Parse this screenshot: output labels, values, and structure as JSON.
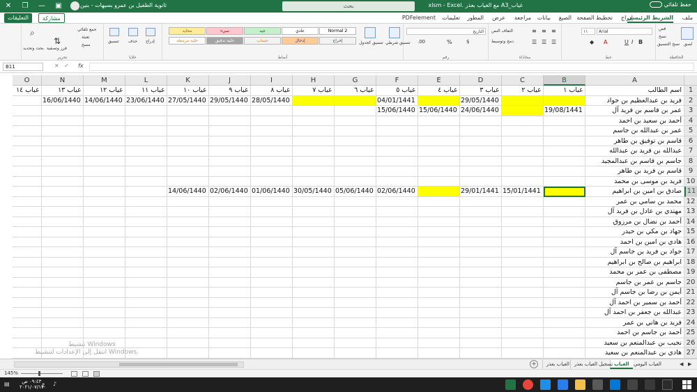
{
  "titlebar": {
    "autosave": "حفظ تلقائي",
    "filename": "غياب_A3 مع الغياب بعذر  .xlsm - Excel",
    "search_placeholder": "بحث",
    "user": "ثانوية الطفيل بن عمرو بسيهات - بنين"
  },
  "ribbon_tabs": [
    "ملف",
    "الشريط الرئيسي",
    "إدراج",
    "تخطيط الصفحة",
    "الصيغ",
    "بيانات",
    "مراجعة",
    "عرض",
    "المطور",
    "تعليمات",
    "PDFelement"
  ],
  "ribbon_active_tab": "الشريط الرئيسي",
  "share_label": "مشاركة",
  "comments_label": "التعليقات",
  "ribbon": {
    "clipboard": {
      "label": "الحافظة",
      "paste": "لصق",
      "cut": "قص",
      "copy": "نسخ",
      "format_painter": "نسخ التنسيق"
    },
    "font": {
      "label": "خط",
      "name": "Arial",
      "size": "١١"
    },
    "alignment": {
      "label": "محاذاة",
      "wrap": "التفاف النص",
      "merge": "دمج وتوسيط"
    },
    "number": {
      "label": "رقم",
      "format": "التاريخ",
      "percent": "%"
    },
    "styles": {
      "label": "أنماط",
      "conditional": "تنسيق شرطي",
      "format_table": "تنسيق كجدول",
      "items": [
        {
          "name": "Normal 2",
          "bg": "#ffffff",
          "fg": "#000000"
        },
        {
          "name": "عادي",
          "bg": "#ffffff",
          "fg": "#000000"
        },
        {
          "name": "جيد",
          "bg": "#c6efce",
          "fg": "#006100"
        },
        {
          "name": "سيء",
          "bg": "#ffc7ce",
          "fg": "#9c0006"
        },
        {
          "name": "محايد",
          "bg": "#ffeb9c",
          "fg": "#9c5700"
        },
        {
          "name": "إخراج",
          "bg": "#f2f2f2",
          "fg": "#3f3f3f"
        },
        {
          "name": "إدخال",
          "bg": "#ffcc99",
          "fg": "#3f3f76"
        },
        {
          "name": "حساب",
          "bg": "#f2f2f2",
          "fg": "#fa7d00"
        },
        {
          "name": "خلية تدقيق",
          "bg": "#a5a5a5",
          "fg": "#ffffff"
        },
        {
          "name": "خلية مرتبطة",
          "bg": "#ffffff",
          "fg": "#fa7d00"
        }
      ]
    },
    "cells": {
      "label": "خلايا",
      "insert": "إدراج",
      "delete": "حذف",
      "format": "تنسيق"
    },
    "editing": {
      "label": "تحرير",
      "autosum": "جمع تلقائي",
      "fill": "تعبئة",
      "clear": "مسح",
      "sort": "فرز وتصفية",
      "find": "بحث وتحديد"
    }
  },
  "formula_bar": {
    "name_box": "B11",
    "fx": "fx",
    "value": ""
  },
  "grid": {
    "columns": [
      "A",
      "B",
      "C",
      "D",
      "E",
      "F",
      "G",
      "H",
      "I",
      "J",
      "K",
      "L",
      "M",
      "N",
      "O"
    ],
    "selected_column": "B",
    "selected_row": 11,
    "active_cell": "B11",
    "rows": [
      {
        "n": 1,
        "cells": [
          "اسم الطالب",
          "غياب ١",
          "غياب ٢",
          "غياب ٣",
          "غياب ٤",
          "غياب ٥",
          "غياب ٦",
          "غياب ٧",
          "غياب ٨",
          "غياب ٩",
          "غياب ١٠",
          "غياب ١١",
          "غياب ١٢",
          "غياب ١٣",
          "غياب ١٤"
        ]
      },
      {
        "n": 2,
        "cells": [
          "فريد بن عبدالعظيم بن جواد",
          "",
          "",
          "29/05/1440",
          "",
          "04/01/1441",
          "",
          "",
          "28/05/1440",
          "29/05/1440",
          "27/05/1440",
          "23/06/1440",
          "14/06/1440",
          "16/06/1440",
          ""
        ]
      },
      {
        "n": 3,
        "cells": [
          "عمر بن قاسم بن فريد آل",
          "19/08/1441",
          "",
          "24/06/1440",
          "15/06/1440",
          "15/06/1440",
          "",
          "",
          "",
          "",
          "",
          "",
          "",
          "",
          ""
        ]
      },
      {
        "n": 4,
        "cells": [
          "أحمد بن سعيد بن احمد"
        ]
      },
      {
        "n": 5,
        "cells": [
          "عمر بن عبدالله بن جاسم"
        ]
      },
      {
        "n": 6,
        "cells": [
          "قاسم بن توفيق بن طاهر"
        ]
      },
      {
        "n": 7,
        "cells": [
          "عبدالله بن فريد بن عبدالله"
        ]
      },
      {
        "n": 8,
        "cells": [
          "جاسم بن قاسم بن عبدالمجيد"
        ]
      },
      {
        "n": 9,
        "cells": [
          "قاسم بن فريد بن طاهر"
        ]
      },
      {
        "n": 10,
        "cells": [
          "فريد بن موسى بن محمد"
        ]
      },
      {
        "n": 11,
        "cells": [
          "صادق بن امين بن ابراهيم",
          "",
          "15/01/1441",
          "29/01/1441",
          "",
          "02/06/1440",
          "05/06/1440",
          "30/05/1440",
          "01/06/1440",
          "02/06/1440",
          "14/06/1440",
          "",
          "",
          "",
          ""
        ]
      },
      {
        "n": 12,
        "cells": [
          "محمد بن سامي بن عمر"
        ]
      },
      {
        "n": 13,
        "cells": [
          "مهتدي بن عادل بن فريد آل"
        ]
      },
      {
        "n": 14,
        "cells": [
          "أحمد بن نضال بن مرزوق"
        ]
      },
      {
        "n": 15,
        "cells": [
          "جهاد بن مكي بن حيدر"
        ]
      },
      {
        "n": 16,
        "cells": [
          "هادي بن امين بن احمد"
        ]
      },
      {
        "n": 17,
        "cells": [
          "جواد بن فريد بن جاسم آل"
        ]
      },
      {
        "n": 18,
        "cells": [
          "ابراهيم بن صالح بن ابراهيم"
        ]
      },
      {
        "n": 19,
        "cells": [
          "مصطفى بن عمر بن محمد"
        ]
      },
      {
        "n": 20,
        "cells": [
          "جاسم بن عمر بن جاسم"
        ]
      },
      {
        "n": 21,
        "cells": [
          "أيمن بن رضا بن جاسم آل"
        ]
      },
      {
        "n": 22,
        "cells": [
          "أحمد بن سمير بن احمد آل"
        ]
      },
      {
        "n": 23,
        "cells": [
          "عبدالله بن جعفر بن احمد آل"
        ]
      },
      {
        "n": 24,
        "cells": [
          "فريد بن هاني بن عمر"
        ]
      },
      {
        "n": 25,
        "cells": [
          "أحمد بن جاسم بن احمد"
        ]
      },
      {
        "n": 26,
        "cells": [
          "نجيب بن عبدالمنعم بن سعيد"
        ]
      },
      {
        "n": 27,
        "cells": [
          "هادي بن عبدالمنعم بن سعيد"
        ]
      }
    ],
    "highlighted": [
      "B2",
      "C2",
      "E2",
      "G2",
      "H2",
      "C3",
      "B11",
      "E11"
    ],
    "highlight_color": "#ffff00",
    "watermark_title": "تنشيط Windows",
    "watermark_sub": "انتقل إلى الإعدادات لتنشيط Windows."
  },
  "sheet_tabs": [
    "الغياب اليومي",
    "الغياب",
    "تسجيل الغياب بعذر",
    "الغياب بعذر"
  ],
  "active_sheet": "الغياب",
  "status": {
    "zoom": "145%"
  },
  "taskbar": {
    "time": "٠٩:٤٣ ص",
    "date": "٢٠٢١/٠٧/١٧",
    "lang": "ع"
  }
}
